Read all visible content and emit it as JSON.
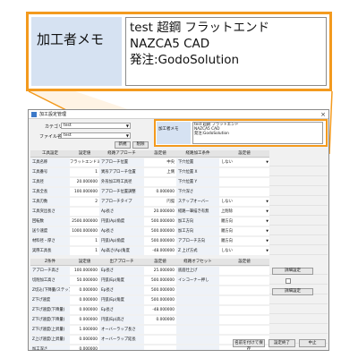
{
  "zoom": {
    "label": "加工者メモ",
    "text": "test 超鋼 フラットエンド\nNAZCA5 CAD\n発注:GodoSolution"
  },
  "window": {
    "title": "加工設定管理",
    "close": "×"
  },
  "form": {
    "category_label": "カテゴリ",
    "category_value": "test",
    "filename_label": "ファイル名",
    "filename_value": "test",
    "btn_new": "新規",
    "btn_delete": "削除"
  },
  "memo": {
    "label": "加工者メモ",
    "text": "test 超鋼 フラットエンド\nNAZCA5 CAD\n発注:GodoSolution"
  },
  "grid": {
    "headers": [
      "工具設定",
      "設定値",
      "経路アプローチ",
      "設定値",
      "経路加工条件",
      "設定値"
    ],
    "rows": [
      [
        "工具名称",
        "フラットエンドミル",
        "アプローチ位置",
        "中央",
        "下穴位置",
        "しない"
      ],
      [
        "工具番号",
        "1",
        "異形アプローチ位置",
        "上側",
        "下穴位置 X",
        ""
      ],
      [
        "工具径",
        "20.000000",
        "外形加工時工具径",
        "",
        "下穴位置 Y",
        ""
      ],
      [
        "工具全長",
        "100.000000",
        "アプローチ位置調整",
        "0.000000",
        "下穴深さ",
        ""
      ],
      [
        "工具刃数",
        "2",
        "アプローチタイプ",
        "円弧",
        "ステップオーバー",
        "しない"
      ],
      [
        "工具突出長さ",
        "",
        "Ap長さ",
        "20.000000",
        "経路一筆描き有無",
        "上削除"
      ],
      [
        "回転数",
        "2500.000000",
        "円弧(Ap)角度",
        "500.000000",
        "加工方向",
        "順方向"
      ],
      [
        "送り速度",
        "1000.000000",
        "Ap長さ",
        "500.000000",
        "加工方向",
        "順方向"
      ],
      [
        "材料径・厚さ",
        "1",
        "円弧(Ap)角度",
        "500.000000",
        "アプローチ方向",
        "順方向"
      ],
      [
        "実際工具長",
        "1",
        "Ap高さ(Ap)角度",
        "-48.000000",
        "Z 上げ方式",
        "しない"
      ]
    ],
    "section2_headers": [
      "Z条件",
      "設定値",
      "出アプローチ",
      "設定値",
      "経路オフセット",
      "設定値"
    ],
    "rows2": [
      [
        "アプローチ高さ",
        "100.000000",
        "Ep長さ",
        "25.000000",
        "底面仕上げ",
        ""
      ],
      [
        "切削加工高さ",
        "50.000000",
        "円弧(Ep)角度",
        "500.000000",
        "インコーナー押し",
        ""
      ],
      [
        "Z切込(下降量/ステップ)",
        "0.000000",
        "Ep長さ",
        "500.000000",
        "",
        ""
      ],
      [
        "Z下げ速度",
        "0.000000",
        "円弧(Ep)角度",
        "500.000000",
        "",
        ""
      ],
      [
        "Z下げ速度(下降量)",
        "0.000000",
        "Ep長さ",
        "-48.000000",
        "",
        ""
      ],
      [
        "Z下げ速度(下降量)",
        "0.000000",
        "円弧(Ep)高さ",
        "0.000000",
        "",
        ""
      ],
      [
        "Z下げ速度(上昇量)",
        "1.000000",
        "オーバーラップ長さ",
        "",
        "",
        ""
      ],
      [
        "Z上げ速度(上昇量)",
        "0.000000",
        "オーバーラップ延長",
        "",
        "",
        ""
      ],
      [
        "加工深さ",
        "0.000000",
        "",
        "",
        "",
        ""
      ]
    ],
    "side_btn1": "詳細設定",
    "side_btn2": "詳細設定"
  },
  "bottom": {
    "save_as": "名前を付けて保存",
    "save": "設定終了",
    "cancel": "中止"
  },
  "colors": {
    "accent": "#f39a1e",
    "label_bg": "#d6e2f2"
  }
}
